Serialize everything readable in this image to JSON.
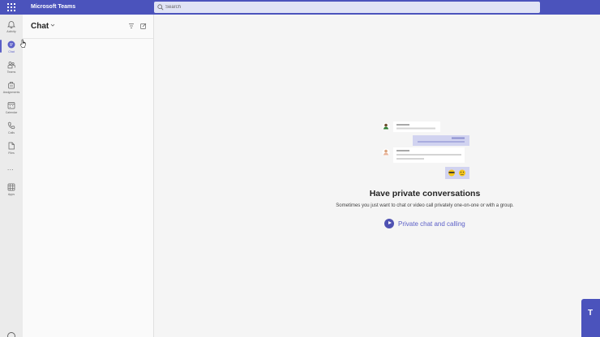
{
  "topbar": {
    "app_title": "Microsoft Teams",
    "search_placeholder": "Search",
    "bg_color": "#4b53bc"
  },
  "rail": {
    "items": [
      {
        "label": "Activity",
        "icon": "bell-icon"
      },
      {
        "label": "Chat",
        "icon": "chat-icon",
        "active": true
      },
      {
        "label": "Teams",
        "icon": "teams-icon"
      },
      {
        "label": "Assignments",
        "icon": "assignments-icon"
      },
      {
        "label": "Calendar",
        "icon": "calendar-icon"
      },
      {
        "label": "Calls",
        "icon": "phone-icon"
      },
      {
        "label": "Files",
        "icon": "file-icon"
      },
      {
        "label": "Apps",
        "icon": "apps-icon"
      }
    ],
    "more_label": "...",
    "accent_color": "#5b5fc7"
  },
  "chat_pane": {
    "title": "Chat"
  },
  "empty_state": {
    "title": "Have private conversations",
    "subtitle": "Sometimes you just want to chat or video call privately one-on-one or with a group.",
    "video_link_label": "Private chat and calling"
  },
  "badge": {
    "letter": "T"
  }
}
